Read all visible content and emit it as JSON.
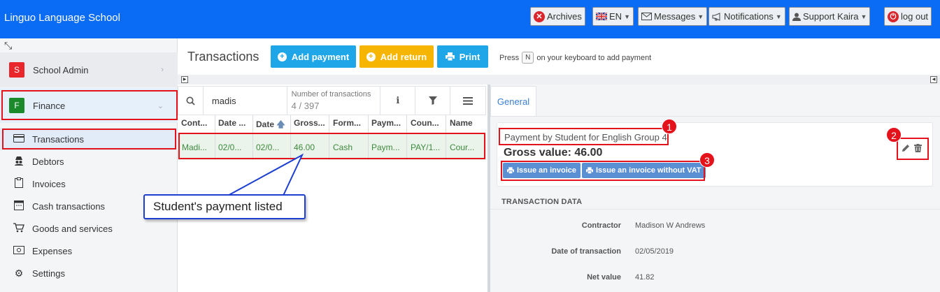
{
  "app": {
    "title": "Linguo Language School"
  },
  "topbar": {
    "archives": "Archives",
    "language": "EN",
    "messages": "Messages",
    "notifications": "Notifications",
    "user": "Support Kaira",
    "logout": "log out"
  },
  "sidebar": {
    "groups": [
      {
        "badge": "S",
        "label": "School Admin",
        "color": "#e8262b"
      },
      {
        "badge": "F",
        "label": "Finance",
        "color": "#1a8a2a"
      }
    ],
    "items": [
      {
        "label": "Transactions",
        "icon": "credit-card-icon"
      },
      {
        "label": "Debtors",
        "icon": "spy-icon"
      },
      {
        "label": "Invoices",
        "icon": "clipboard-icon"
      },
      {
        "label": "Cash transactions",
        "icon": "cash-register-icon"
      },
      {
        "label": "Goods and services",
        "icon": "cart-icon"
      },
      {
        "label": "Expenses",
        "icon": "money-bill-icon"
      },
      {
        "label": "Settings",
        "icon": "gear-icon"
      }
    ]
  },
  "main": {
    "title": "Transactions",
    "buttons": {
      "add_payment": "Add payment",
      "add_return": "Add return",
      "print": "Print"
    },
    "hint": {
      "pre": "Press",
      "key": "N",
      "post": "on your keyboard to add payment"
    }
  },
  "list": {
    "search_value": "madis",
    "count_label": "Number of transactions",
    "count_value": "4 / 397",
    "columns": [
      "Cont...",
      "Date ...",
      "Date",
      "Gross...",
      "Form...",
      "Paym...",
      "Coun...",
      "Name"
    ],
    "row": [
      "Madi...",
      "02/0...",
      "02/0...",
      "46.00",
      "Cash",
      "Paym...",
      "PAY/1...",
      "Cour..."
    ]
  },
  "detail": {
    "tab": "General",
    "description": "Payment by Student for English Group 4",
    "gross": "Gross value: 46.00",
    "issue_invoice": "Issue an invoice",
    "issue_invoice_novat": "Issue an invoice without VAT",
    "section": "TRANSACTION DATA",
    "fields": [
      {
        "label": "Contractor",
        "value": "Madison W Andrews"
      },
      {
        "label": "Date of transaction",
        "value": "02/05/2019"
      },
      {
        "label": "Net value",
        "value": "41.82"
      }
    ]
  },
  "annotations": {
    "callout": "Student's payment listed",
    "markers": [
      "1",
      "2",
      "3"
    ]
  }
}
